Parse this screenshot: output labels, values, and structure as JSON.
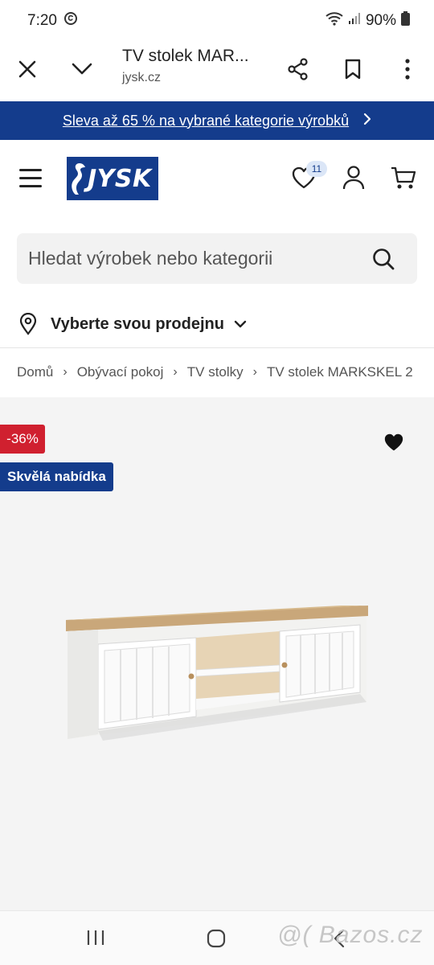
{
  "status_bar": {
    "time": "7:20",
    "battery": "90%"
  },
  "browser": {
    "title": "TV stolek MAR...",
    "url": "jysk.cz"
  },
  "promo": {
    "text": "Sleva až 65 % na vybrané kategorie výrobků"
  },
  "header": {
    "logo_text": "JYSK",
    "wishlist_count": "11"
  },
  "search": {
    "placeholder": "Hledat výrobek nebo kategorii"
  },
  "store": {
    "label": "Vyberte svou prodejnu"
  },
  "breadcrumb": {
    "items": [
      "Domů",
      "Obývací pokoj",
      "TV stolky",
      "TV stolek MARKSKEL 2"
    ]
  },
  "product": {
    "discount_badge": "-36%",
    "offer_badge": "Skvělá nabídka"
  },
  "watermark": "@( Bazos.cz",
  "colors": {
    "brand_blue": "#143c8c",
    "discount_red": "#d0202f"
  }
}
